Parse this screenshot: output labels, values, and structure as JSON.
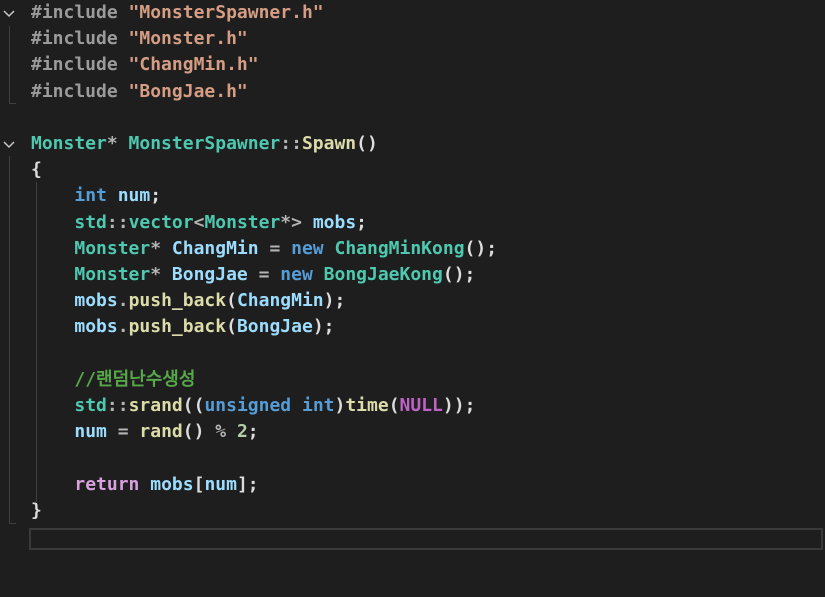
{
  "editor": {
    "lines": [
      [
        {
          "t": "#include ",
          "c": "pre"
        },
        {
          "t": "\"MonsterSpawner.h\"",
          "c": "str"
        }
      ],
      [
        {
          "t": "#include ",
          "c": "pre"
        },
        {
          "t": "\"Monster.h\"",
          "c": "str"
        }
      ],
      [
        {
          "t": "#include ",
          "c": "pre"
        },
        {
          "t": "\"ChangMin.h\"",
          "c": "str"
        }
      ],
      [
        {
          "t": "#include ",
          "c": "pre"
        },
        {
          "t": "\"BongJae.h\"",
          "c": "str"
        }
      ],
      [],
      [
        {
          "t": "Monster",
          "c": "type"
        },
        {
          "t": "* ",
          "c": "op"
        },
        {
          "t": "MonsterSpawner",
          "c": "type"
        },
        {
          "t": "::",
          "c": "op"
        },
        {
          "t": "Spawn",
          "c": "fn"
        },
        {
          "t": "()",
          "c": "punc"
        }
      ],
      [
        {
          "t": "{",
          "c": "punc"
        }
      ],
      [
        {
          "t": "    ",
          "c": "punc"
        },
        {
          "t": "int",
          "c": "kw"
        },
        {
          "t": " ",
          "c": "punc"
        },
        {
          "t": "num",
          "c": "var"
        },
        {
          "t": ";",
          "c": "punc"
        }
      ],
      [
        {
          "t": "    ",
          "c": "punc"
        },
        {
          "t": "std",
          "c": "type"
        },
        {
          "t": "::",
          "c": "op"
        },
        {
          "t": "vector",
          "c": "type"
        },
        {
          "t": "<",
          "c": "op"
        },
        {
          "t": "Monster",
          "c": "type"
        },
        {
          "t": "*> ",
          "c": "op"
        },
        {
          "t": "mobs",
          "c": "var"
        },
        {
          "t": ";",
          "c": "punc"
        }
      ],
      [
        {
          "t": "    ",
          "c": "punc"
        },
        {
          "t": "Monster",
          "c": "type"
        },
        {
          "t": "* ",
          "c": "op"
        },
        {
          "t": "ChangMin",
          "c": "var"
        },
        {
          "t": " = ",
          "c": "op"
        },
        {
          "t": "new",
          "c": "kw"
        },
        {
          "t": " ",
          "c": "punc"
        },
        {
          "t": "ChangMinKong",
          "c": "type"
        },
        {
          "t": "();",
          "c": "punc"
        }
      ],
      [
        {
          "t": "    ",
          "c": "punc"
        },
        {
          "t": "Monster",
          "c": "type"
        },
        {
          "t": "* ",
          "c": "op"
        },
        {
          "t": "BongJae",
          "c": "var"
        },
        {
          "t": " = ",
          "c": "op"
        },
        {
          "t": "new",
          "c": "kw"
        },
        {
          "t": " ",
          "c": "punc"
        },
        {
          "t": "BongJaeKong",
          "c": "type"
        },
        {
          "t": "();",
          "c": "punc"
        }
      ],
      [
        {
          "t": "    ",
          "c": "punc"
        },
        {
          "t": "mobs",
          "c": "var"
        },
        {
          "t": ".",
          "c": "op"
        },
        {
          "t": "push_back",
          "c": "fn"
        },
        {
          "t": "(",
          "c": "punc"
        },
        {
          "t": "ChangMin",
          "c": "var"
        },
        {
          "t": ");",
          "c": "punc"
        }
      ],
      [
        {
          "t": "    ",
          "c": "punc"
        },
        {
          "t": "mobs",
          "c": "var"
        },
        {
          "t": ".",
          "c": "op"
        },
        {
          "t": "push_back",
          "c": "fn"
        },
        {
          "t": "(",
          "c": "punc"
        },
        {
          "t": "BongJae",
          "c": "var"
        },
        {
          "t": ");",
          "c": "punc"
        }
      ],
      [],
      [
        {
          "t": "    ",
          "c": "punc"
        },
        {
          "t": "//랜덤난수생성",
          "c": "com"
        }
      ],
      [
        {
          "t": "    ",
          "c": "punc"
        },
        {
          "t": "std",
          "c": "type"
        },
        {
          "t": "::",
          "c": "op"
        },
        {
          "t": "srand",
          "c": "fn"
        },
        {
          "t": "((",
          "c": "punc"
        },
        {
          "t": "unsigned",
          "c": "kw"
        },
        {
          "t": " ",
          "c": "punc"
        },
        {
          "t": "int",
          "c": "kw"
        },
        {
          "t": ")",
          "c": "punc"
        },
        {
          "t": "time",
          "c": "fn"
        },
        {
          "t": "(",
          "c": "punc"
        },
        {
          "t": "NULL",
          "c": "macro"
        },
        {
          "t": "));",
          "c": "punc"
        }
      ],
      [
        {
          "t": "    ",
          "c": "punc"
        },
        {
          "t": "num",
          "c": "var"
        },
        {
          "t": " = ",
          "c": "op"
        },
        {
          "t": "rand",
          "c": "fn"
        },
        {
          "t": "() ",
          "c": "punc"
        },
        {
          "t": "%",
          "c": "op"
        },
        {
          "t": " ",
          "c": "punc"
        },
        {
          "t": "2",
          "c": "num"
        },
        {
          "t": ";",
          "c": "punc"
        }
      ],
      [],
      [
        {
          "t": "    ",
          "c": "punc"
        },
        {
          "t": "return",
          "c": "ctl"
        },
        {
          "t": " ",
          "c": "punc"
        },
        {
          "t": "mobs",
          "c": "var"
        },
        {
          "t": "[",
          "c": "punc"
        },
        {
          "t": "num",
          "c": "var"
        },
        {
          "t": "];",
          "c": "punc"
        }
      ],
      [
        {
          "t": "}",
          "c": "punc"
        }
      ],
      []
    ]
  },
  "colors": {
    "background": "#1e1e1e",
    "preprocessor": "#9b9b9b",
    "string": "#d69d85",
    "type": "#4ec9b0",
    "keyword": "#569cd6",
    "control": "#d8a0df",
    "function": "#dcdcaa",
    "variable": "#9cdcfe",
    "comment": "#57a64a",
    "macro": "#bd63c5",
    "number": "#b5cea8"
  },
  "icons": {
    "fold": "chevron-down-icon"
  }
}
